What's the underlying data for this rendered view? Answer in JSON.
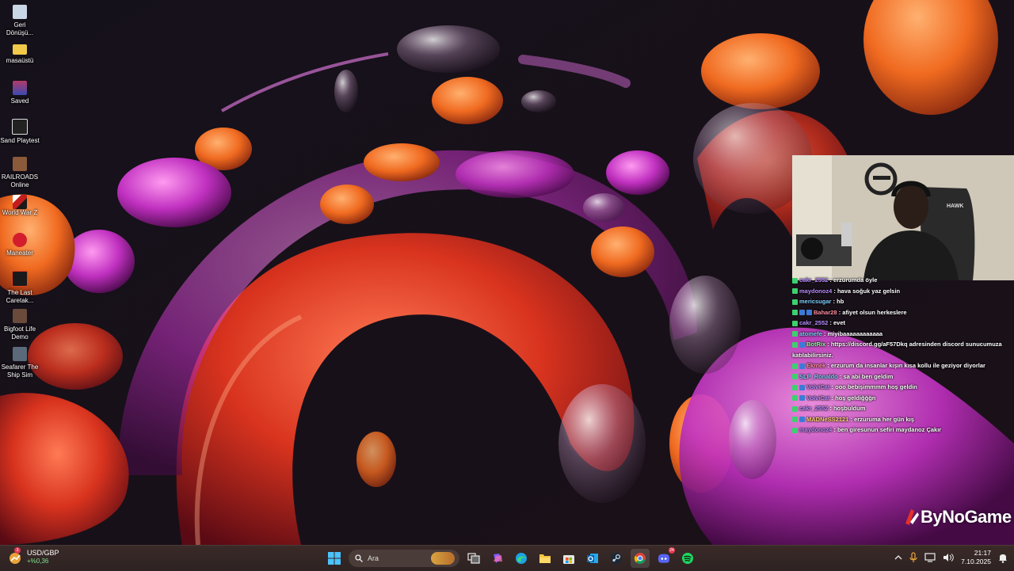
{
  "desktop": {
    "icons": [
      {
        "label": "Geri Dönüşü...",
        "icon": "recycle-bin-icon",
        "color": "#c9d6e6"
      },
      {
        "label": "masaüstü",
        "icon": "folder-icon",
        "color": "#f1c94a"
      },
      {
        "label": "Saved",
        "icon": "winrar-icon",
        "color": "#b23a6a"
      },
      {
        "label": "Sand Playtest",
        "icon": "sand-game-icon",
        "color": "#222222"
      },
      {
        "label": "RAILROADS Online",
        "icon": "railroads-icon",
        "color": "#8a5a3a"
      },
      {
        "label": "World War Z",
        "icon": "wwz-icon",
        "color": "#3a1a1a"
      },
      {
        "label": "Maneater",
        "icon": "maneater-icon",
        "color": "#d41d2c"
      },
      {
        "label": "The Last Caretak...",
        "icon": "last-caretaker-icon",
        "color": "#1a1a1a"
      },
      {
        "label": "Bigfoot Life Demo",
        "icon": "bigfoot-icon",
        "color": "#6a4a3a"
      },
      {
        "label": "Seafarer The Ship Sim",
        "icon": "seafarer-icon",
        "color": "#5a6a7a"
      }
    ]
  },
  "chat": {
    "messages": [
      {
        "user": "cakr_2552",
        "text": ": erzurumda öyle",
        "badges": [
          "k"
        ],
        "color": "c1"
      },
      {
        "user": "maydonoz4",
        "text": ": hava soğuk yaz gelsin",
        "badges": [
          "k"
        ],
        "color": "c1"
      },
      {
        "user": "mericsugar",
        "text": ": hb",
        "badges": [
          "k"
        ],
        "color": "c2"
      },
      {
        "user": "Bahar28",
        "text": ": afiyet olsun herkeslere",
        "badges": [
          "k",
          "b",
          "b"
        ],
        "color": "c3"
      },
      {
        "user": "cakr_2552",
        "text": ": evet",
        "badges": [
          "k"
        ],
        "color": "c1"
      },
      {
        "user": "atomefe",
        "text": ": miyibaaaaaaaaaaaa",
        "badges": [
          "k"
        ],
        "color": "c2"
      },
      {
        "user": "BotRix",
        "text": ": https://discord.gg/aF57Dkq adresinden discord sunucumuza katılabilirsiniz.",
        "badges": [
          "k",
          "b"
        ],
        "color": "c4"
      },
      {
        "user": "Ekmek",
        "text": ": erzurum da insanlar kışın kısa kollu ile geziyor diyorlar",
        "badges": [
          "k",
          "b"
        ],
        "color": "c3"
      },
      {
        "user": "SLP_Ronaldo",
        "text": ": sa abi ben geldim",
        "badges": [
          "k"
        ],
        "color": "c2"
      },
      {
        "user": "VolviCat",
        "text": ": ooo bebişimmmm hoş geldin",
        "badges": [
          "k",
          "b"
        ],
        "color": "c1"
      },
      {
        "user": "VolviCat",
        "text": ": hoş geldiğğğn",
        "badges": [
          "k",
          "b"
        ],
        "color": "c1"
      },
      {
        "user": "cakr_2552",
        "text": ": hoşbuldum",
        "badges": [
          "k"
        ],
        "color": "c1"
      },
      {
        "user": "MADNeSS2121",
        "text": ": erzuruma her gün kış",
        "badges": [
          "k",
          "b"
        ],
        "color": "c5"
      },
      {
        "user": "maydonoz4",
        "text": ": ben giresunun sefiri maydanoz Çakır",
        "badges": [
          "k"
        ],
        "color": "c1"
      }
    ]
  },
  "brand": {
    "text": "ByNoGame"
  },
  "taskbar": {
    "ticker": {
      "name": "USD/GBP",
      "value": "+%0,36",
      "badge": "3"
    },
    "search_placeholder": "Ara",
    "apps": [
      {
        "name": "start-button",
        "icon": "windows-icon"
      },
      {
        "name": "task-view-button",
        "icon": "task-view-icon"
      },
      {
        "name": "copilot-button",
        "icon": "copilot-icon"
      },
      {
        "name": "edge-button",
        "icon": "edge-icon"
      },
      {
        "name": "file-explorer-button",
        "icon": "folder-icon"
      },
      {
        "name": "store-button",
        "icon": "store-icon"
      },
      {
        "name": "outlook-button",
        "icon": "outlook-icon"
      },
      {
        "name": "steam-button",
        "icon": "steam-icon"
      },
      {
        "name": "chrome-button",
        "icon": "chrome-icon"
      },
      {
        "name": "discord-button",
        "icon": "discord-icon"
      },
      {
        "name": "spotify-button",
        "icon": "spotify-icon"
      }
    ],
    "discord_badge": "24",
    "clock": {
      "time": "21:17",
      "date": "7.10.2025"
    }
  }
}
